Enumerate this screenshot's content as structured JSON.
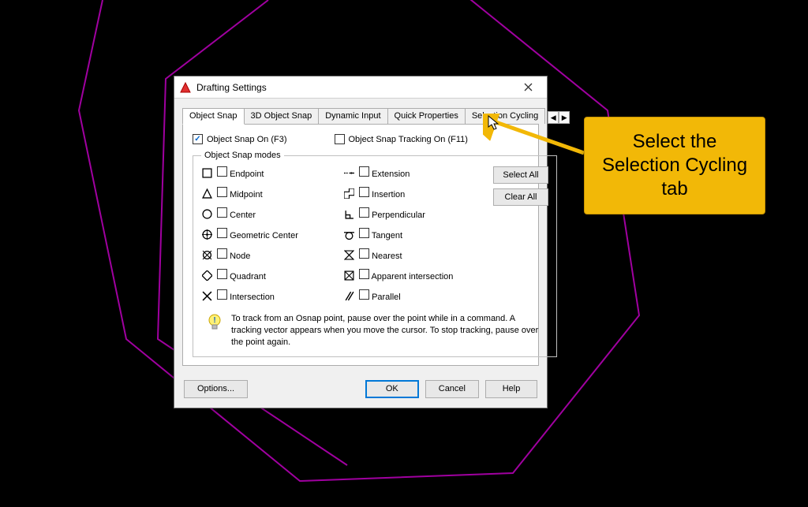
{
  "dialog": {
    "title": "Drafting Settings",
    "tabs": [
      {
        "label": "Object Snap"
      },
      {
        "label": "3D Object Snap"
      },
      {
        "label": "Dynamic Input"
      },
      {
        "label": "Quick Properties"
      },
      {
        "label": "Selection Cycling"
      }
    ],
    "toggles": {
      "osnap_on": "Object Snap On (F3)",
      "osnap_track": "Object Snap Tracking On (F11)"
    },
    "modes_legend": "Object Snap modes",
    "modes_left": [
      {
        "icon": "endpoint",
        "label": "Endpoint"
      },
      {
        "icon": "midpoint",
        "label": "Midpoint"
      },
      {
        "icon": "center",
        "label": "Center"
      },
      {
        "icon": "gcenter",
        "label": "Geometric Center"
      },
      {
        "icon": "node",
        "label": "Node"
      },
      {
        "icon": "quadrant",
        "label": "Quadrant"
      },
      {
        "icon": "intersection",
        "label": "Intersection"
      }
    ],
    "modes_right": [
      {
        "icon": "extension",
        "label": "Extension"
      },
      {
        "icon": "insertion",
        "label": "Insertion"
      },
      {
        "icon": "perpendicular",
        "label": "Perpendicular"
      },
      {
        "icon": "tangent",
        "label": "Tangent"
      },
      {
        "icon": "nearest",
        "label": "Nearest"
      },
      {
        "icon": "appint",
        "label": "Apparent intersection"
      },
      {
        "icon": "parallel",
        "label": "Parallel"
      }
    ],
    "buttons": {
      "select_all": "Select All",
      "clear_all": "Clear All"
    },
    "tip": "To track from an Osnap point, pause over the point while in a command.  A tracking vector appears when you move the cursor.  To stop tracking, pause over the point again.",
    "footer": {
      "options": "Options...",
      "ok": "OK",
      "cancel": "Cancel",
      "help": "Help"
    }
  },
  "callout": "Select the Selection Cycling tab"
}
